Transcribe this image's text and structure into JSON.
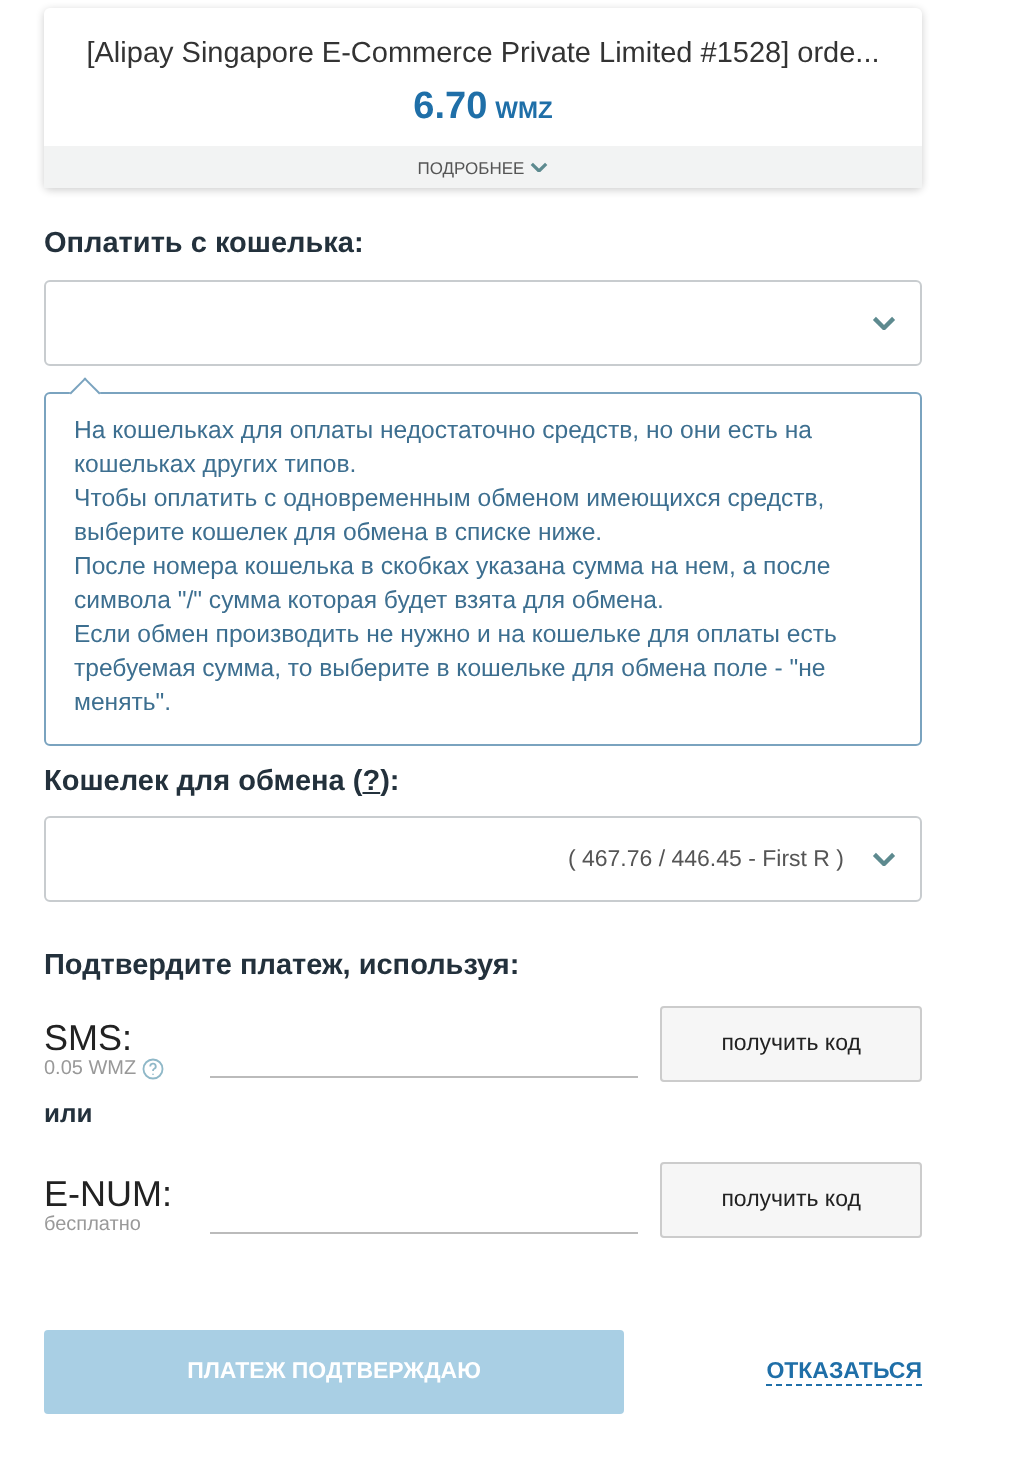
{
  "order_card": {
    "title": "[Alipay Singapore E-Commerce Private Limited #1528] orde...",
    "amount": "6.70",
    "currency": "WMZ",
    "details_link": "ПОДРОБНЕЕ"
  },
  "pay_from": {
    "label": "Оплатить с кошелька:"
  },
  "hint": {
    "paragraphs": [
      "На кошельках для оплаты недостаточно средств, но они есть на кошельках других типов.",
      "Чтобы оплатить с одновременным обменом имеющихся средств, выберите кошелек для обмена в списке ниже.",
      "После номера кошелька в скобках указана сумма на нем, а после символа \"/\" сумма которая будет взята для обмена.",
      "Если обмен производить не нужно и на кошельке для оплаты есть требуемая сумма, то выберите в кошельке для обмена поле - \"не менять\"."
    ]
  },
  "exchange_wallet": {
    "label": "Кошелек для обмена (",
    "help": "?",
    "label_end": "):",
    "value": "( 467.76 / 446.45 - First R )"
  },
  "confirm": {
    "heading": "Подтвердите платеж, используя:",
    "methods": [
      {
        "name": "SMS:",
        "note": "0.05 WMZ",
        "has_help": true,
        "button": "получить код"
      },
      {
        "name": "E-NUM:",
        "note": "бесплатно",
        "has_help": false,
        "button": "получить код"
      }
    ],
    "separator": "или"
  },
  "actions": {
    "submit": {
      "label": "ПЛАТЕЖ ПОДТВЕРЖДАЮ",
      "disabled": true
    },
    "cancel": "ОТКАЗАТЬСЯ"
  }
}
